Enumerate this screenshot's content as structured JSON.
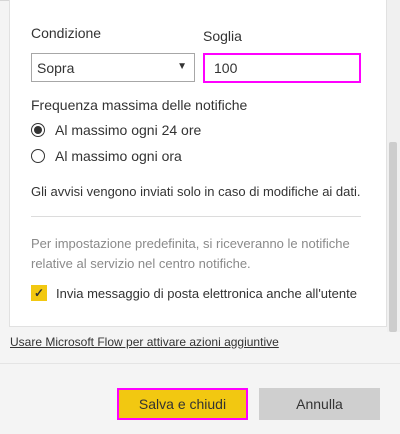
{
  "form": {
    "condition_label": "Condizione",
    "condition_value": "Sopra",
    "threshold_label": "Soglia",
    "threshold_value": "100",
    "frequency_label": "Frequenza massima delle notifiche",
    "frequency_options": [
      {
        "label": "Al massimo ogni 24 ore",
        "checked": true
      },
      {
        "label": "Al massimo ogni ora",
        "checked": false
      }
    ],
    "info_text": "Gli avvisi vengono inviati solo in caso di modifiche ai dati.",
    "default_notice": "Per impostazione predefinita, si riceveranno le notifiche relative al servizio nel centro notifiche.",
    "email_checkbox_label": "Invia messaggio di posta elettronica anche all'utente",
    "email_checkbox_checked": true
  },
  "flow_link": "Usare Microsoft Flow per attivare azioni aggiuntive",
  "buttons": {
    "save": "Salva e chiudi",
    "cancel": "Annulla"
  },
  "colors": {
    "accent": "#f2c811",
    "highlight": "#ff00ff"
  }
}
